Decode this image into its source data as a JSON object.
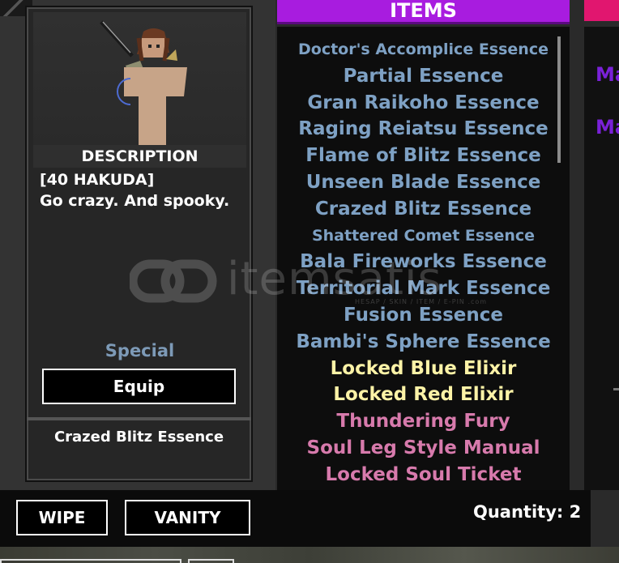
{
  "description_panel": {
    "heading": "DESCRIPTION",
    "text": "[40 HAKUDA]\nGo crazy. And spooky.",
    "rarity": "Special",
    "equip_label": "Equip",
    "selected_name": "Crazed Blitz Essence"
  },
  "items": {
    "header": "ITEMS",
    "list": [
      {
        "label": "Doctor's Accomplice Essence",
        "color": "#7ea1c4"
      },
      {
        "label": "Partial Essence",
        "color": "#7ea1c4"
      },
      {
        "label": "Gran Raikoho Essence",
        "color": "#7ea1c4"
      },
      {
        "label": "Raging Reiatsu Essence",
        "color": "#7ea1c4"
      },
      {
        "label": "Flame of Blitz Essence",
        "color": "#7ea1c4"
      },
      {
        "label": "Unseen Blade Essence",
        "color": "#7ea1c4"
      },
      {
        "label": "Crazed Blitz Essence",
        "color": "#7ea1c4"
      },
      {
        "label": "Shattered Comet Essence",
        "color": "#7ea1c4"
      },
      {
        "label": "Bala Fireworks Essence",
        "color": "#7ea1c4"
      },
      {
        "label": "Territorial Mark Essence",
        "color": "#7ea1c4"
      },
      {
        "label": "Fusion Essence",
        "color": "#7ea1c4"
      },
      {
        "label": "Bambi's Sphere Essence",
        "color": "#7ea1c4"
      },
      {
        "label": "Locked Blue Elixir",
        "color": "#fdf3a7"
      },
      {
        "label": "Locked Red Elixir",
        "color": "#fdf3a7"
      },
      {
        "label": "Thundering Fury",
        "color": "#d77aac"
      },
      {
        "label": "Soul Leg Style Manual",
        "color": "#d77aac"
      },
      {
        "label": "Locked Soul Ticket",
        "color": "#d77aac"
      }
    ]
  },
  "right_panel": {
    "labels": [
      "Ma",
      "Ma"
    ],
    "label_color": "#7a21d8",
    "header_color": "#e1166f"
  },
  "bottom_bar": {
    "wipe_label": "WIPE",
    "vanity_label": "VANITY",
    "quantity": "Quantity: 2"
  },
  "watermark": {
    "text": "itemsatis",
    "subtext": "HESAP / SKIN / ITEM / E-PIN .com"
  },
  "colors": {
    "accent_purple": "#a81cdf",
    "rarity_blue": "#7d9ab7"
  }
}
